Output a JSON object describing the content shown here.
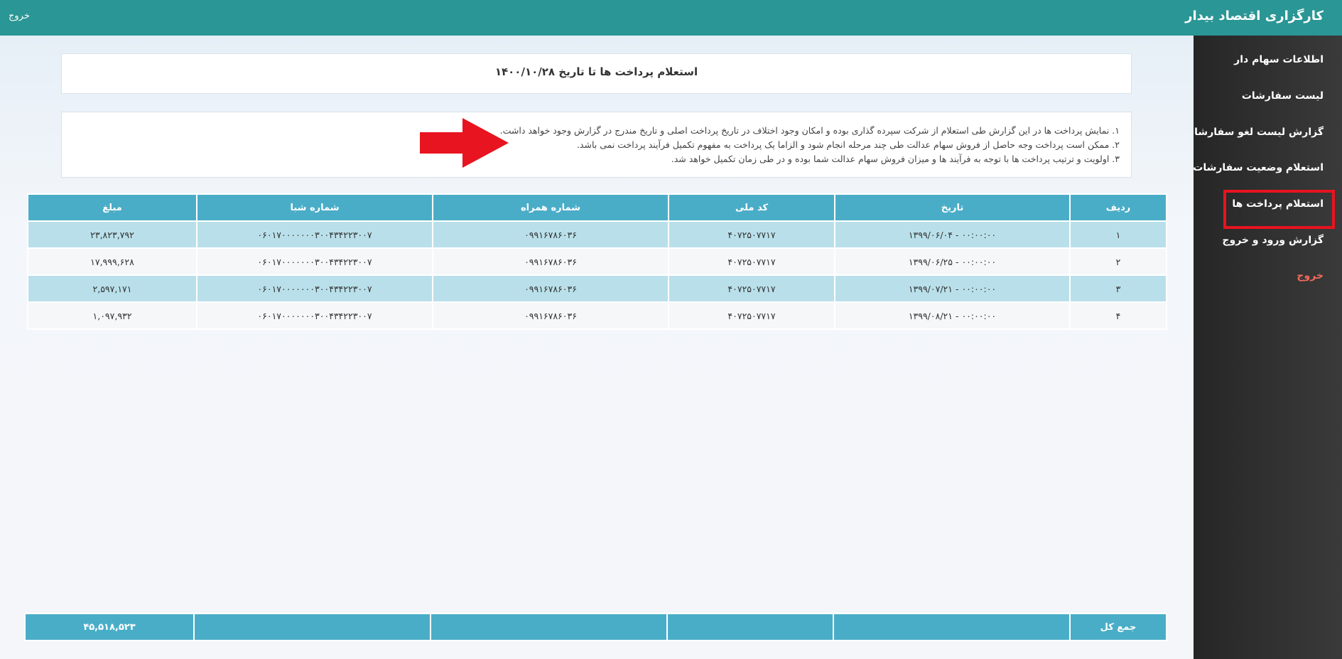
{
  "header": {
    "brand": "کارگزاری اقتصاد بیدار",
    "logout": "خروج"
  },
  "sidebar": {
    "items": [
      {
        "label": "اطلاعات سهام دار"
      },
      {
        "label": "لیست سفارشات"
      },
      {
        "label": "گزارش لیست لغو سفارشات"
      },
      {
        "label": "استعلام وضعیت سفارشات"
      },
      {
        "label": "استعلام پرداخت ها"
      },
      {
        "label": "گزارش ورود و خروج"
      },
      {
        "label": "خروج"
      }
    ]
  },
  "page": {
    "title": "استعلام پرداخت ها تا تاریخ ۱۴۰۰/۱۰/۲۸",
    "notes": [
      "۱. نمایش پرداخت ها در این گزارش طی استعلام از شرکت سپرده گذاری بوده و امکان وجود اختلاف در تاریخ پرداخت اصلی و تاریخ مندرج در گزارش وجود خواهد داشت.",
      "۲. ممکن است پرداخت وجه حاصل از فروش سهام عدالت طی چند مرحله انجام شود و الزاما یک پرداخت به مفهوم تکمیل فرآیند پرداخت نمی باشد.",
      "۳. اولویت و ترتیب پرداخت ها با توجه به فرآیند ها و میزان فروش سهام عدالت شما بوده و در طی زمان تکمیل خواهد شد."
    ]
  },
  "table": {
    "headers": [
      "ردیف",
      "تاریخ",
      "کد ملی",
      "شماره همراه",
      "شماره شبا",
      "مبلغ"
    ],
    "rows": [
      [
        "۱",
        "۰۰:۰۰:۰۰ - ۱۳۹۹/۰۶/۰۴",
        "۴۰۷۲۵۰۷۷۱۷",
        "۰۹۹۱۶۷۸۶۰۳۶",
        "۰۶۰۱۷۰۰۰۰۰۰۰۳۰۰۴۳۴۲۲۳۰۰۷",
        "۲۳,۸۲۳,۷۹۲"
      ],
      [
        "۲",
        "۰۰:۰۰:۰۰ - ۱۳۹۹/۰۶/۲۵",
        "۴۰۷۲۵۰۷۷۱۷",
        "۰۹۹۱۶۷۸۶۰۳۶",
        "۰۶۰۱۷۰۰۰۰۰۰۰۳۰۰۴۳۴۲۲۳۰۰۷",
        "۱۷,۹۹۹,۶۲۸"
      ],
      [
        "۳",
        "۰۰:۰۰:۰۰ - ۱۳۹۹/۰۷/۲۱",
        "۴۰۷۲۵۰۷۷۱۷",
        "۰۹۹۱۶۷۸۶۰۳۶",
        "۰۶۰۱۷۰۰۰۰۰۰۰۳۰۰۴۳۴۲۲۳۰۰۷",
        "۲,۵۹۷,۱۷۱"
      ],
      [
        "۴",
        "۰۰:۰۰:۰۰ - ۱۳۹۹/۰۸/۲۱",
        "۴۰۷۲۵۰۷۷۱۷",
        "۰۹۹۱۶۷۸۶۰۳۶",
        "۰۶۰۱۷۰۰۰۰۰۰۰۳۰۰۴۳۴۲۲۳۰۰۷",
        "۱,۰۹۷,۹۳۲"
      ]
    ],
    "total_label": "جمع کل",
    "total_value": "۴۵,۵۱۸,۵۲۳"
  },
  "colors": {
    "header_bg": "#2a9695",
    "table_header": "#4aadc8",
    "row_highlight": "#b9e0ea",
    "highlight_border": "#e8141f",
    "arrow": "#e8141f"
  }
}
